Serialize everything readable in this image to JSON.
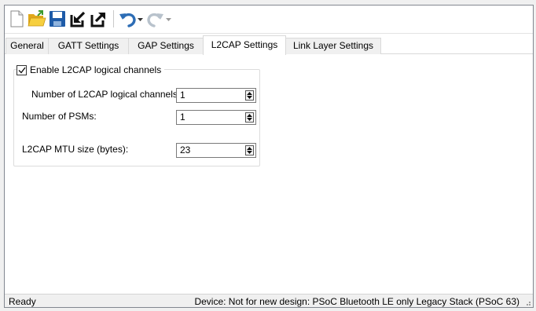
{
  "toolbar": {
    "buttons": [
      {
        "icon": "new-file-icon"
      },
      {
        "icon": "open-folder-icon"
      },
      {
        "icon": "save-icon"
      },
      {
        "icon": "import-icon"
      },
      {
        "icon": "export-icon"
      },
      {
        "icon": "undo-icon"
      },
      {
        "icon": "redo-icon"
      }
    ]
  },
  "tabs": [
    {
      "label": "General"
    },
    {
      "label": "GATT Settings"
    },
    {
      "label": "GAP Settings"
    },
    {
      "label": "L2CAP Settings",
      "active": true
    },
    {
      "label": "Link Layer Settings"
    }
  ],
  "l2cap": {
    "enable_label": "Enable L2CAP logical channels",
    "enable_checked": true,
    "channels_label": "Number of L2CAP logical channels:",
    "channels_value": "1",
    "psms_label": "Number of PSMs:",
    "psms_value": "1",
    "mtu_label": "L2CAP MTU size (bytes):",
    "mtu_value": "23"
  },
  "status": {
    "left": "Ready",
    "right": "Device: Not for new design: PSoC Bluetooth LE only Legacy Stack (PSoC 63)"
  },
  "colors": {
    "accent_blue": "#2d6db5",
    "folder_yellow": "#f2c230",
    "save_blue": "#1e5ba8"
  }
}
